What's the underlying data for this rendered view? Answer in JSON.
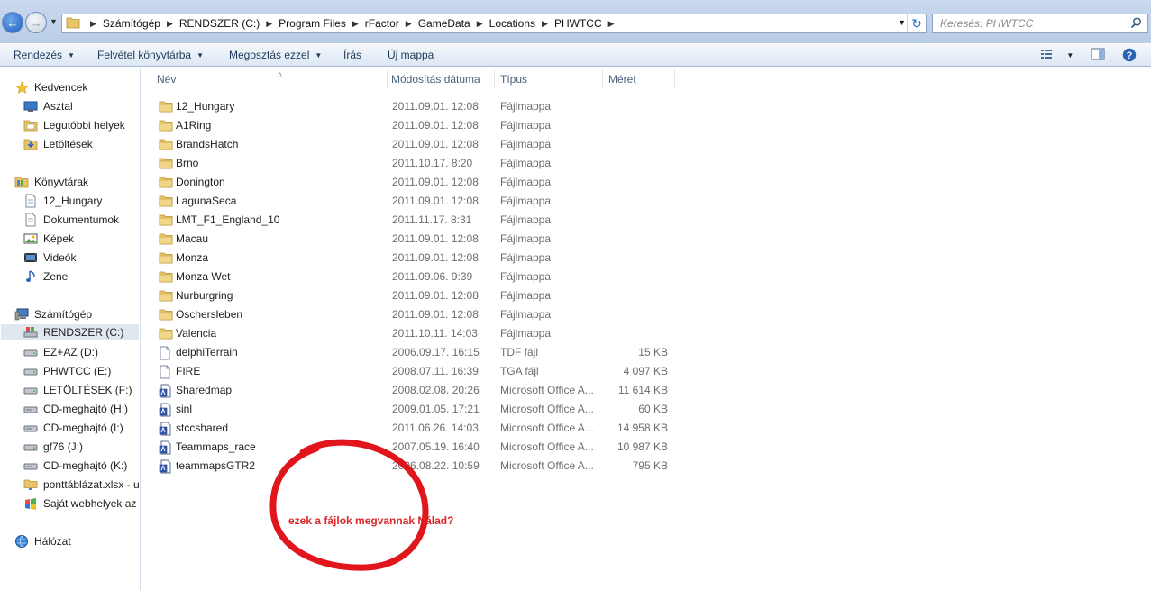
{
  "address": {
    "breadcrumbs": [
      "Számítógép",
      "RENDSZER (C:)",
      "Program Files",
      "rFactor",
      "GameData",
      "Locations",
      "PHWTCC"
    ]
  },
  "search": {
    "placeholder": "Keresés: PHWTCC"
  },
  "toolbar": {
    "organize": "Rendezés",
    "library": "Felvétel könyvtárba",
    "share": "Megosztás ezzel",
    "burn": "Írás",
    "new_folder": "Új mappa"
  },
  "sidebar": {
    "favorites": {
      "label": "Kedvencek",
      "items": [
        "Asztal",
        "Legutóbbi helyek",
        "Letöltések"
      ]
    },
    "libraries": {
      "label": "Könyvtárak",
      "items": [
        "12_Hungary",
        "Dokumentumok",
        "Képek",
        "Videók",
        "Zene"
      ]
    },
    "computer": {
      "label": "Számítógép",
      "items": [
        "RENDSZER (C:)",
        "EZ+AZ (D:)",
        "PHWTCC (E:)",
        "LETÖLTÉSEK (F:)",
        "CD-meghajtó (H:)",
        "CD-meghajtó (I:)",
        "gf76 (J:)",
        "CD-meghajtó (K:)",
        "ponttáblázat.xlsx - u",
        "Saját webhelyek az M"
      ]
    },
    "network": {
      "label": "Hálózat"
    }
  },
  "columns": {
    "name": "Név",
    "date": "Módosítás dátuma",
    "type": "Típus",
    "size": "Méret"
  },
  "files": [
    {
      "name": "12_Hungary",
      "date": "2011.09.01. 12:08",
      "type": "Fájlmappa",
      "size": "",
      "icon": "folder-icon"
    },
    {
      "name": "A1Ring",
      "date": "2011.09.01. 12:08",
      "type": "Fájlmappa",
      "size": "",
      "icon": "folder-icon"
    },
    {
      "name": "BrandsHatch",
      "date": "2011.09.01. 12:08",
      "type": "Fájlmappa",
      "size": "",
      "icon": "folder-icon"
    },
    {
      "name": "Brno",
      "date": "2011.10.17. 8:20",
      "type": "Fájlmappa",
      "size": "",
      "icon": "folder-icon"
    },
    {
      "name": "Donington",
      "date": "2011.09.01. 12:08",
      "type": "Fájlmappa",
      "size": "",
      "icon": "folder-icon"
    },
    {
      "name": "LagunaSeca",
      "date": "2011.09.01. 12:08",
      "type": "Fájlmappa",
      "size": "",
      "icon": "folder-icon"
    },
    {
      "name": "LMT_F1_England_10",
      "date": "2011.11.17. 8:31",
      "type": "Fájlmappa",
      "size": "",
      "icon": "folder-icon"
    },
    {
      "name": "Macau",
      "date": "2011.09.01. 12:08",
      "type": "Fájlmappa",
      "size": "",
      "icon": "folder-icon"
    },
    {
      "name": "Monza",
      "date": "2011.09.01. 12:08",
      "type": "Fájlmappa",
      "size": "",
      "icon": "folder-icon"
    },
    {
      "name": "Monza Wet",
      "date": "2011.09.06. 9:39",
      "type": "Fájlmappa",
      "size": "",
      "icon": "folder-icon"
    },
    {
      "name": "Nurburgring",
      "date": "2011.09.01. 12:08",
      "type": "Fájlmappa",
      "size": "",
      "icon": "folder-icon"
    },
    {
      "name": "Oschersleben",
      "date": "2011.09.01. 12:08",
      "type": "Fájlmappa",
      "size": "",
      "icon": "folder-icon"
    },
    {
      "name": "Valencia",
      "date": "2011.10.11. 14:03",
      "type": "Fájlmappa",
      "size": "",
      "icon": "folder-icon"
    },
    {
      "name": "delphiTerrain",
      "date": "2006.09.17. 16:15",
      "type": "TDF fájl",
      "size": "15 KB",
      "icon": "file-icon"
    },
    {
      "name": "FIRE",
      "date": "2008.07.11. 16:39",
      "type": "TGA fájl",
      "size": "4 097 KB",
      "icon": "file-icon"
    },
    {
      "name": "Sharedmap",
      "date": "2008.02.08. 20:26",
      "type": "Microsoft Office A...",
      "size": "11 614 KB",
      "icon": "office-file-icon"
    },
    {
      "name": "sinl",
      "date": "2009.01.05. 17:21",
      "type": "Microsoft Office A...",
      "size": "60 KB",
      "icon": "office-file-icon"
    },
    {
      "name": "stccshared",
      "date": "2011.06.26. 14:03",
      "type": "Microsoft Office A...",
      "size": "14 958 KB",
      "icon": "office-file-icon"
    },
    {
      "name": "Teammaps_race",
      "date": "2007.05.19. 16:40",
      "type": "Microsoft Office A...",
      "size": "10 987 KB",
      "icon": "office-file-icon"
    },
    {
      "name": "teammapsGTR2",
      "date": "2006.08.22. 10:59",
      "type": "Microsoft Office A...",
      "size": "795 KB",
      "icon": "office-file-icon"
    }
  ],
  "annotation": {
    "text": "ezek a fájlok megvannak Nálad?"
  },
  "colors": {
    "annotation_red": "#d9262a",
    "selected_bg": "#e0e7f0",
    "toolbar_text": "#1e395b"
  }
}
